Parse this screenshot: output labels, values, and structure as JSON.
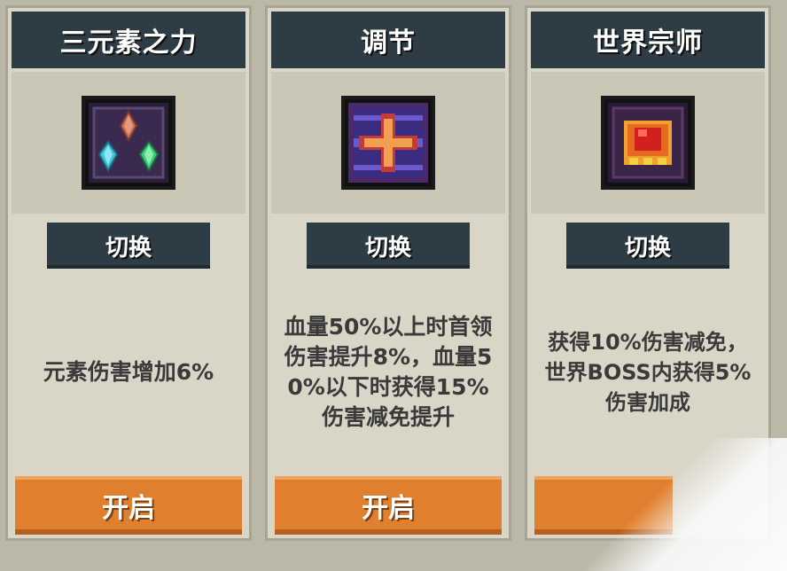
{
  "cards": [
    {
      "title": "三元素之力",
      "icon": "three-crystals-icon",
      "switch_label": "切换",
      "description": "元素伤害增加6%",
      "open_label": "开启"
    },
    {
      "title": "调节",
      "icon": "red-cross-icon",
      "switch_label": "切换",
      "description": "血量50%以上时首领\n伤害提升8%，血量5\n0%以下时获得15%\n伤害减免提升",
      "open_label": "开启"
    },
    {
      "title": "世界宗师",
      "icon": "red-gem-icon",
      "switch_label": "切换",
      "description": "获得10%伤害减免，\n世界BOSS内获得5%\n伤害加成",
      "open_label": ""
    }
  ],
  "colors": {
    "header_bg": "#2e3d45",
    "open_button": "#e0802e",
    "card_bg": "#d9d6c8"
  }
}
